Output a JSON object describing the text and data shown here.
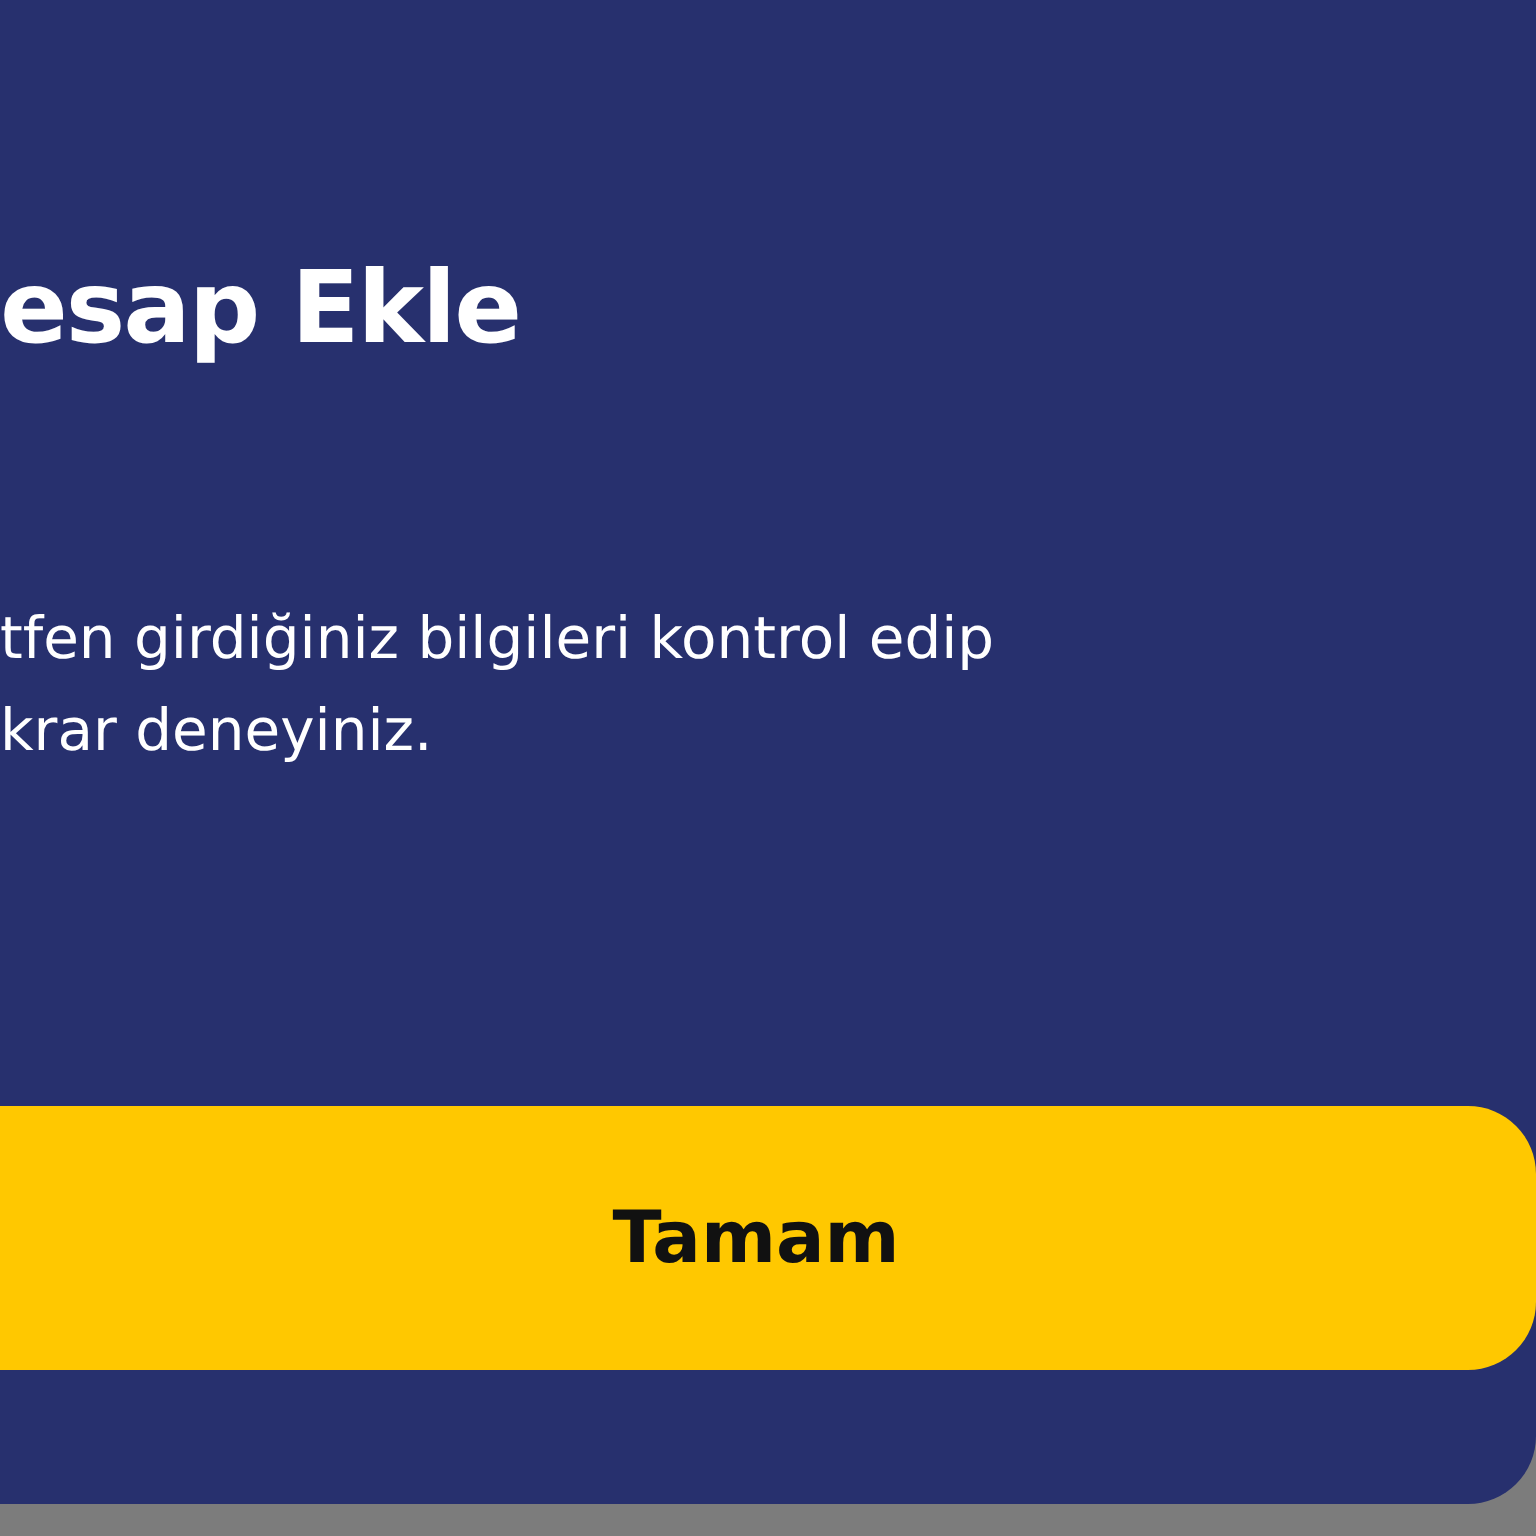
{
  "dialog": {
    "title": "esap Ekle",
    "message_lines": [
      "tfen girdiğiniz bilgileri kontrol edip",
      "krar deneyiniz."
    ],
    "button": "Tamam"
  }
}
